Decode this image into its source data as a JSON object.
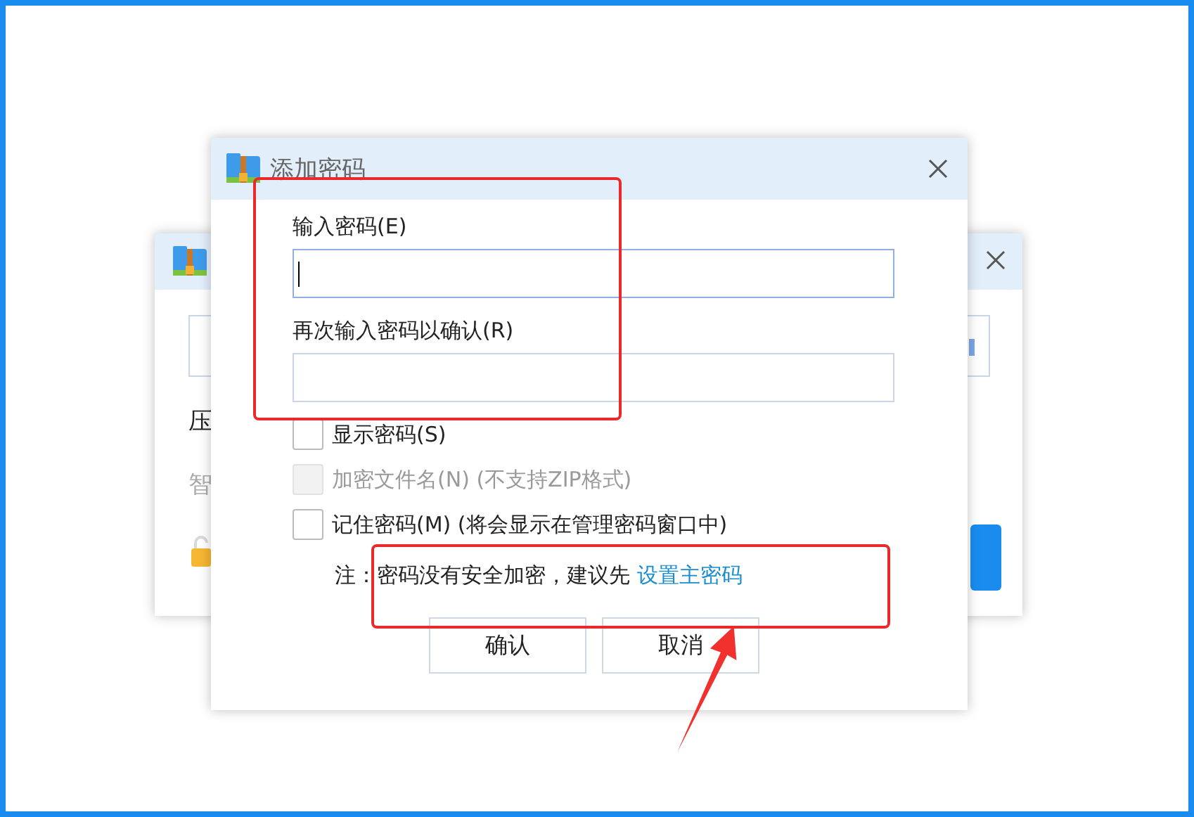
{
  "back_window": {
    "labels": [
      {
        "text": "压",
        "disabled": false
      },
      {
        "text": "智",
        "disabled": true
      }
    ]
  },
  "dialog": {
    "title": "添加密码",
    "fields": [
      {
        "label": "输入密码(E)",
        "focused": true
      },
      {
        "label": "再次输入密码以确认(R)",
        "focused": false
      }
    ],
    "checkboxes": [
      {
        "label": "显示密码(S)",
        "checked": false,
        "disabled": false
      },
      {
        "label": "加密文件名(N) (不支持ZIP格式)",
        "checked": false,
        "disabled": true
      },
      {
        "label": "记住密码(M) (将会显示在管理密码窗口中)",
        "checked": false,
        "disabled": false
      }
    ],
    "note": {
      "text": "注：密码没有安全加密，建议先",
      "link": "设置主密码"
    },
    "buttons": [
      "确认",
      "取消"
    ]
  }
}
